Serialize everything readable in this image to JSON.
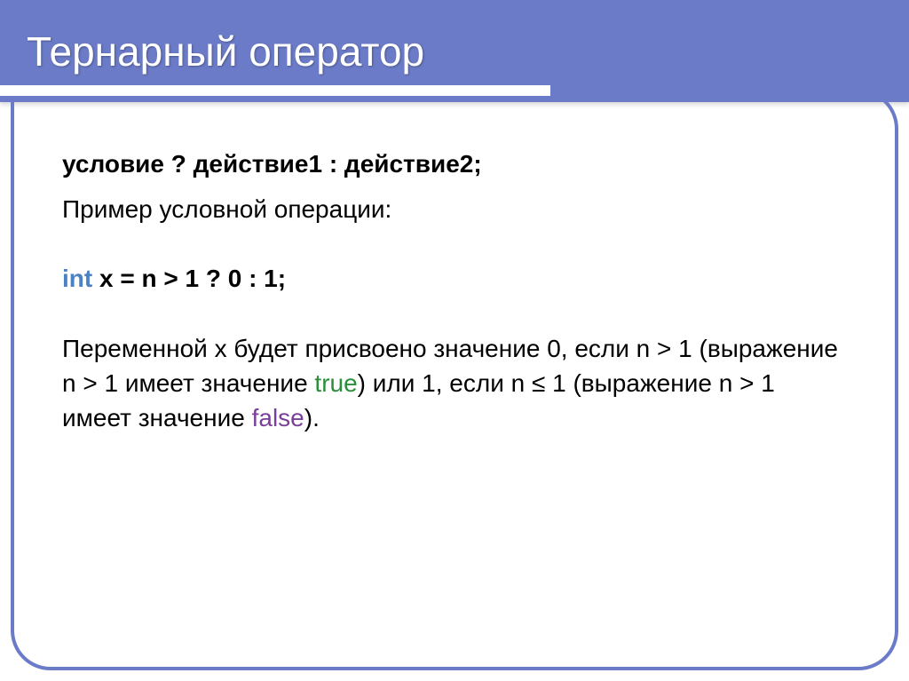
{
  "title": "Тернарный оператор",
  "syntax": "условие ? действие1 : действие2;",
  "example_label": "Пример условной операции:",
  "code": {
    "kw_int": "int",
    "rest": " x = n > 1 ? 0 : 1;"
  },
  "explanation": {
    "part1": "Переменной x будет присвоено значение 0, если n > 1 (выражение n > 1 имеет значение ",
    "true": "true",
    "part2": ") или 1, если n ≤ 1 (выражение n > 1 имеет значение ",
    "false": "false",
    "part3": ")."
  }
}
